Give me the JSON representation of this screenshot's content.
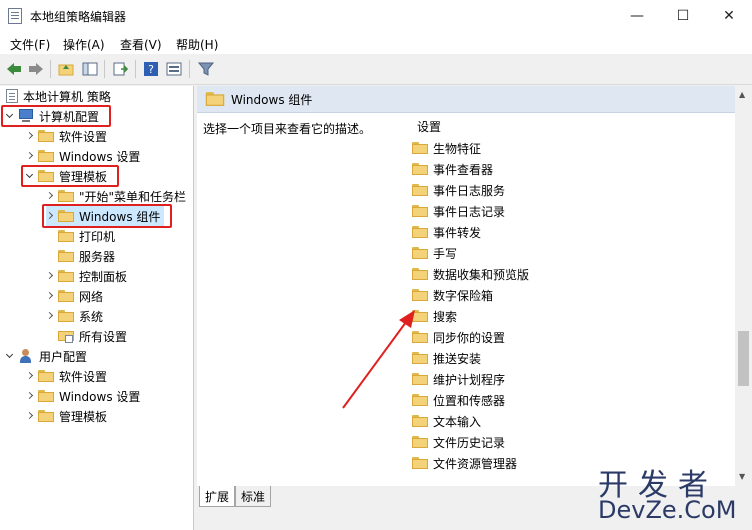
{
  "window": {
    "title": "本地组策略编辑器",
    "minimize": "—",
    "maximize": "☐",
    "close": "✕"
  },
  "menu": [
    "文件(F)",
    "操作(A)",
    "查看(V)",
    "帮助(H)"
  ],
  "tree": {
    "root": "本地计算机 策略",
    "computer_config": "计算机配置",
    "software_settings": "软件设置",
    "windows_settings": "Windows 设置",
    "admin_templates": "管理模板",
    "start_menu": "\"开始\"菜单和任务栏",
    "windows_components": "Windows 组件",
    "printers": "打印机",
    "servers": "服务器",
    "control_panel": "控制面板",
    "network": "网络",
    "system": "系统",
    "all_settings": "所有设置",
    "user_config": "用户配置",
    "user_software_settings": "软件设置",
    "user_windows_settings": "Windows 设置",
    "user_admin_templates": "管理模板"
  },
  "details": {
    "header": "Windows 组件",
    "description": "选择一个项目来查看它的描述。",
    "column_header": "设置",
    "items": [
      "生物特征",
      "事件查看器",
      "事件日志服务",
      "事件日志记录",
      "事件转发",
      "手写",
      "数据收集和预览版",
      "数字保险箱",
      "搜索",
      "同步你的设置",
      "推送安装",
      "维护计划程序",
      "位置和传感器",
      "文本输入",
      "文件历史记录",
      "文件资源管理器"
    ]
  },
  "tabs": [
    "扩展",
    "标准"
  ],
  "watermark": {
    "cn": "开发者",
    "en": "DevZe.CoM"
  }
}
